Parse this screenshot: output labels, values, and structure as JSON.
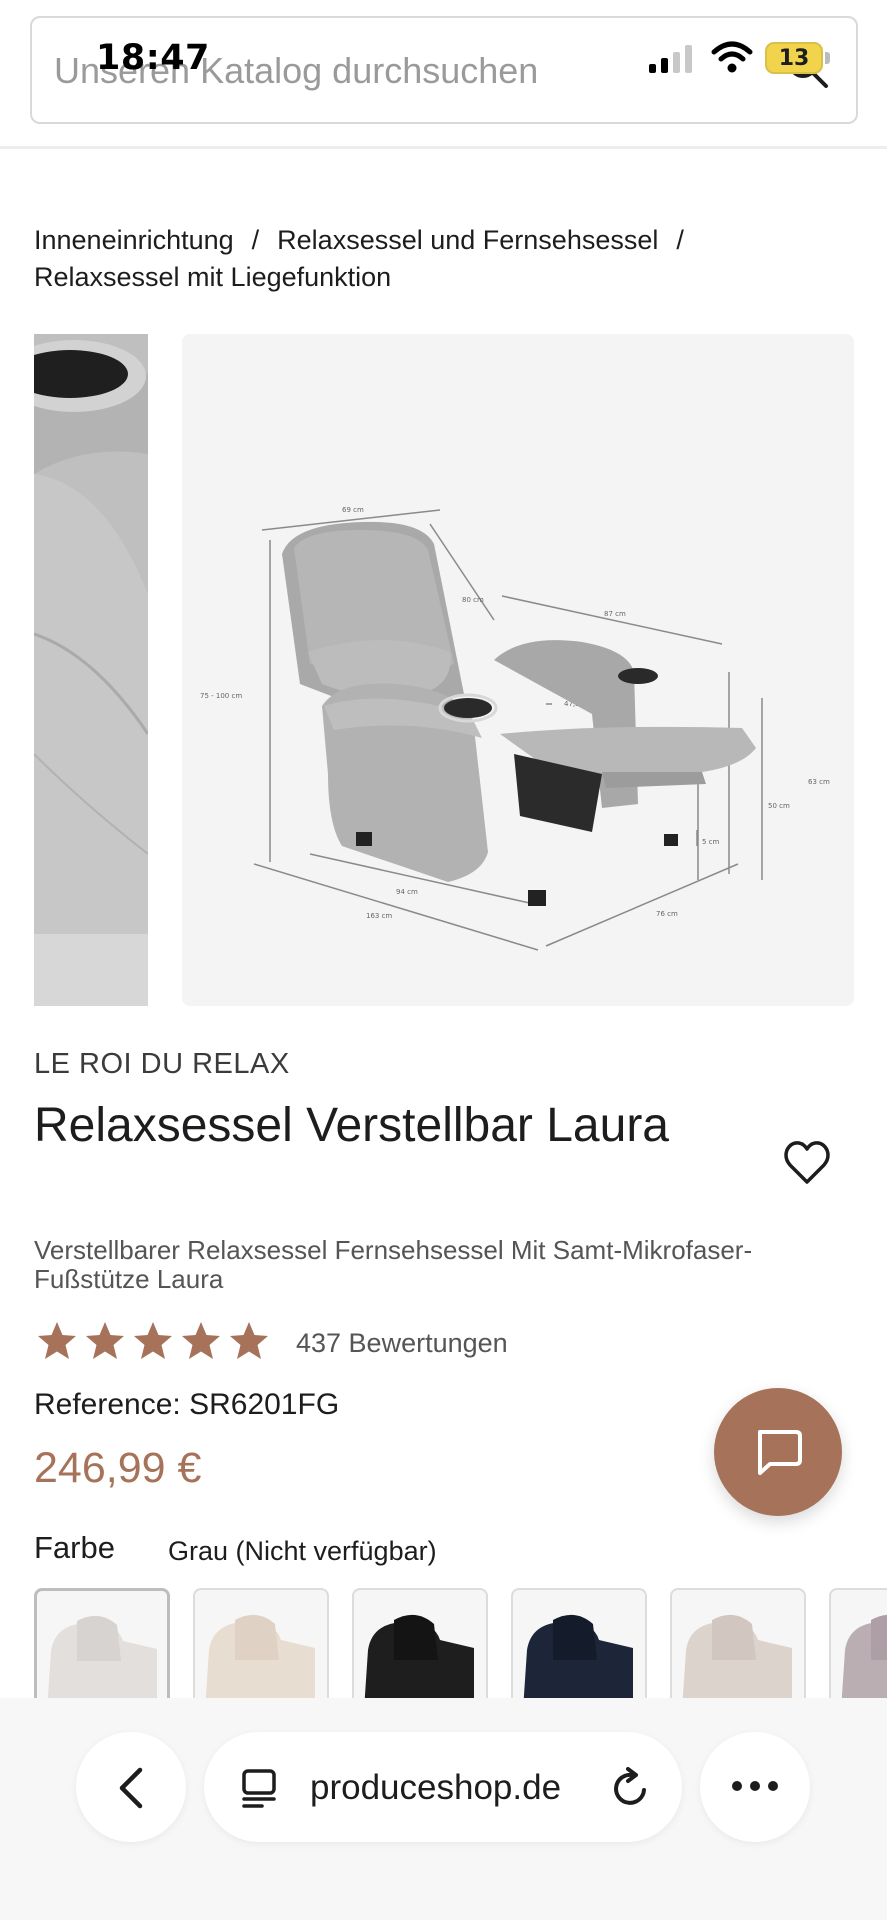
{
  "status_bar": {
    "time": "18:47",
    "battery": "13"
  },
  "search": {
    "placeholder": "Unseren Katalog durchsuchen"
  },
  "breadcrumb": {
    "items": [
      "Inneneinrichtung",
      "Relaxsessel und Fernsehsessel",
      "Relaxsessel mit Liegefunktion"
    ],
    "separator": "/"
  },
  "gallery": {
    "dimensions": {
      "width_top": "69 cm",
      "back_height": "80 cm",
      "depth_arm": "87 cm",
      "total_height": "75 - 100 cm",
      "seat_width": "47,5 cm",
      "footrest_height": "63 cm",
      "seat_height": "50 cm",
      "ground": "5 cm",
      "width_bottom": "94 cm",
      "length_total": "163 cm",
      "depth_bottom": "76 cm"
    }
  },
  "product": {
    "brand": "LE ROI DU RELAX",
    "title": "Relaxsessel Verstellbar Laura",
    "subtitle": "Verstellbarer Relaxsessel Fernsehsessel Mit Samt-Mikrofaser-Fußstütze Laura",
    "rating": 5,
    "reviews": "437 Bewertungen",
    "reference": "Reference: SR6201FG",
    "price": "246,99 €",
    "color_label": "Farbe",
    "color_value": "Grau (Nicht verfügbar)"
  },
  "swatches": [
    {
      "name": "grau",
      "color": "#d9d6d3",
      "selected": true
    },
    {
      "name": "beige",
      "color": "#e3d8cc",
      "selected": false
    },
    {
      "name": "schwarz",
      "color": "#1c1c1c",
      "selected": false
    },
    {
      "name": "blau",
      "color": "#1b2436",
      "selected": false
    },
    {
      "name": "taupe",
      "color": "#d8cfc9",
      "selected": false
    },
    {
      "name": "mauve",
      "color": "#b7a9ae",
      "selected": false
    }
  ],
  "browser": {
    "url": "produceshop.de"
  },
  "colors": {
    "accent": "#a6735a",
    "star": "#a6735a",
    "text": "#1d1d1f"
  }
}
